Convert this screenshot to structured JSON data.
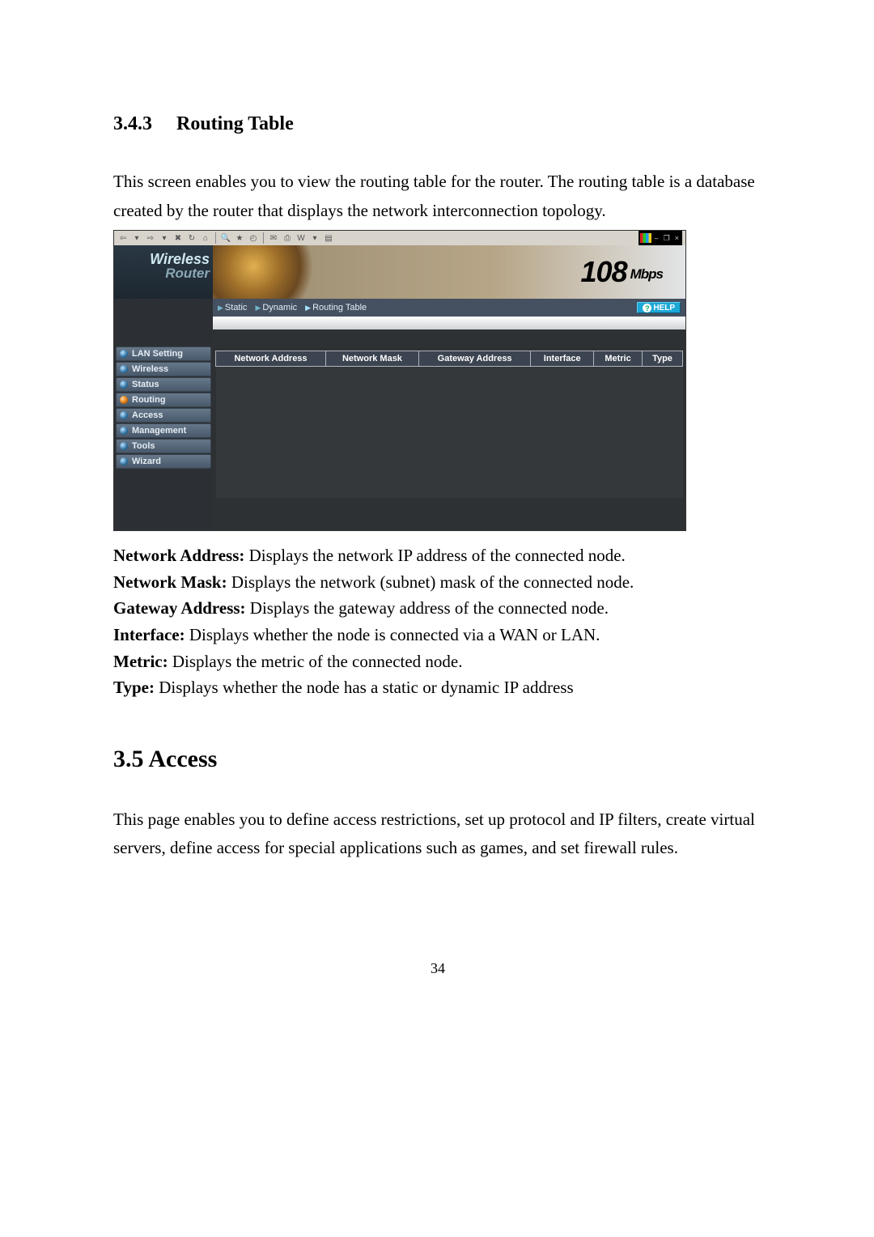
{
  "section": {
    "number": "3.4.3",
    "title": "Routing Table",
    "intro": "This screen enables you to view the routing table for the router. The routing table is a database created by the router that displays the network interconnection topology."
  },
  "definitions": [
    {
      "term": "Network Address:",
      "desc": " Displays the network IP address of the connected node."
    },
    {
      "term": "Network Mask:",
      "desc": " Displays the network (subnet) mask of the connected node."
    },
    {
      "term": "Gateway Address:",
      "desc": " Displays the gateway address of the connected node."
    },
    {
      "term": "Interface:",
      "desc": " Displays whether the node is connected via a WAN or LAN."
    },
    {
      "term": "Metric:",
      "desc": " Displays the metric of the connected node."
    },
    {
      "term": "Type:",
      "desc": " Displays whether the node has a static or dynamic IP address"
    }
  ],
  "section2": {
    "heading": "3.5 Access",
    "body": "This page enables you to define access restrictions, set up protocol and IP filters, create virtual servers, define access for special applications such as games, and set firewall rules."
  },
  "page_number": "34",
  "router_ui": {
    "logo_line1": "Wireless",
    "logo_line2": "Router",
    "banner_brand_num": "108",
    "banner_brand_unit": "Mbps",
    "tabs": [
      "Static",
      "Dynamic",
      "Routing Table"
    ],
    "tabs_active_index": 2,
    "help_label": "HELP",
    "nav": [
      "LAN Setting",
      "Wireless",
      "Status",
      "Routing",
      "Access",
      "Management",
      "Tools",
      "Wizard"
    ],
    "nav_active_index": 3,
    "table_headers": [
      "Network Address",
      "Network Mask",
      "Gateway Address",
      "Interface",
      "Metric",
      "Type"
    ]
  },
  "ie_toolbar": {
    "window_buttons": [
      "–",
      "❐",
      "×"
    ]
  }
}
